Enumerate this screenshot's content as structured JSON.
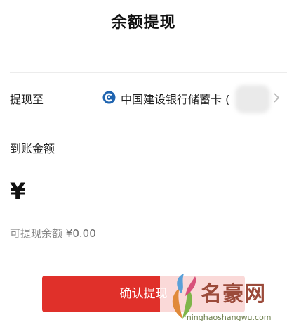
{
  "header": {
    "title": "余额提现"
  },
  "withdraw": {
    "to_label": "提现至",
    "bank_icon": "ccb-bank-icon",
    "card_name": "中国建设银行储蓄卡 (",
    "arrow_icon": "chevron-right-icon"
  },
  "amount": {
    "label": "到账金额",
    "currency": "¥",
    "value": ""
  },
  "balance": {
    "label": "可提现余额",
    "value": "¥0.00"
  },
  "actions": {
    "confirm_label": "确认提现"
  },
  "watermark": {
    "title": "名豪网",
    "url": "minghaoshangwu.com"
  },
  "colors": {
    "accent": "#e0302a",
    "bank_blue": "#1f64b0",
    "muted_text": "#888888"
  }
}
